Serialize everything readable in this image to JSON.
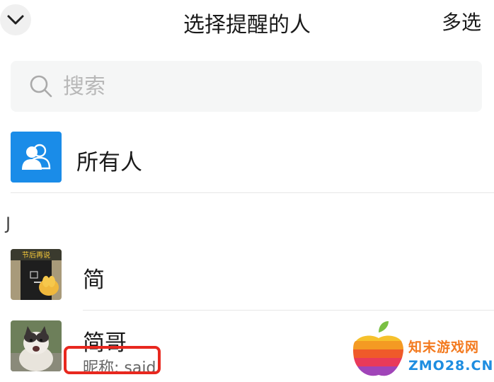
{
  "header": {
    "title": "选择提醒的人",
    "multi_select": "多选"
  },
  "search": {
    "placeholder": "搜索"
  },
  "everyone": {
    "label": "所有人"
  },
  "section_index": "J",
  "contacts": [
    {
      "name": "简",
      "avatar_text": "节后再说"
    },
    {
      "name": "简哥",
      "nickname": "昵称: said"
    }
  ],
  "watermark": {
    "cn": "知末游戏网",
    "en": "ZMO28.CN"
  },
  "colors": {
    "everyone_icon": "#1a8ce8",
    "highlight_border": "#e8281f",
    "search_bg": "#f5f6f6"
  }
}
